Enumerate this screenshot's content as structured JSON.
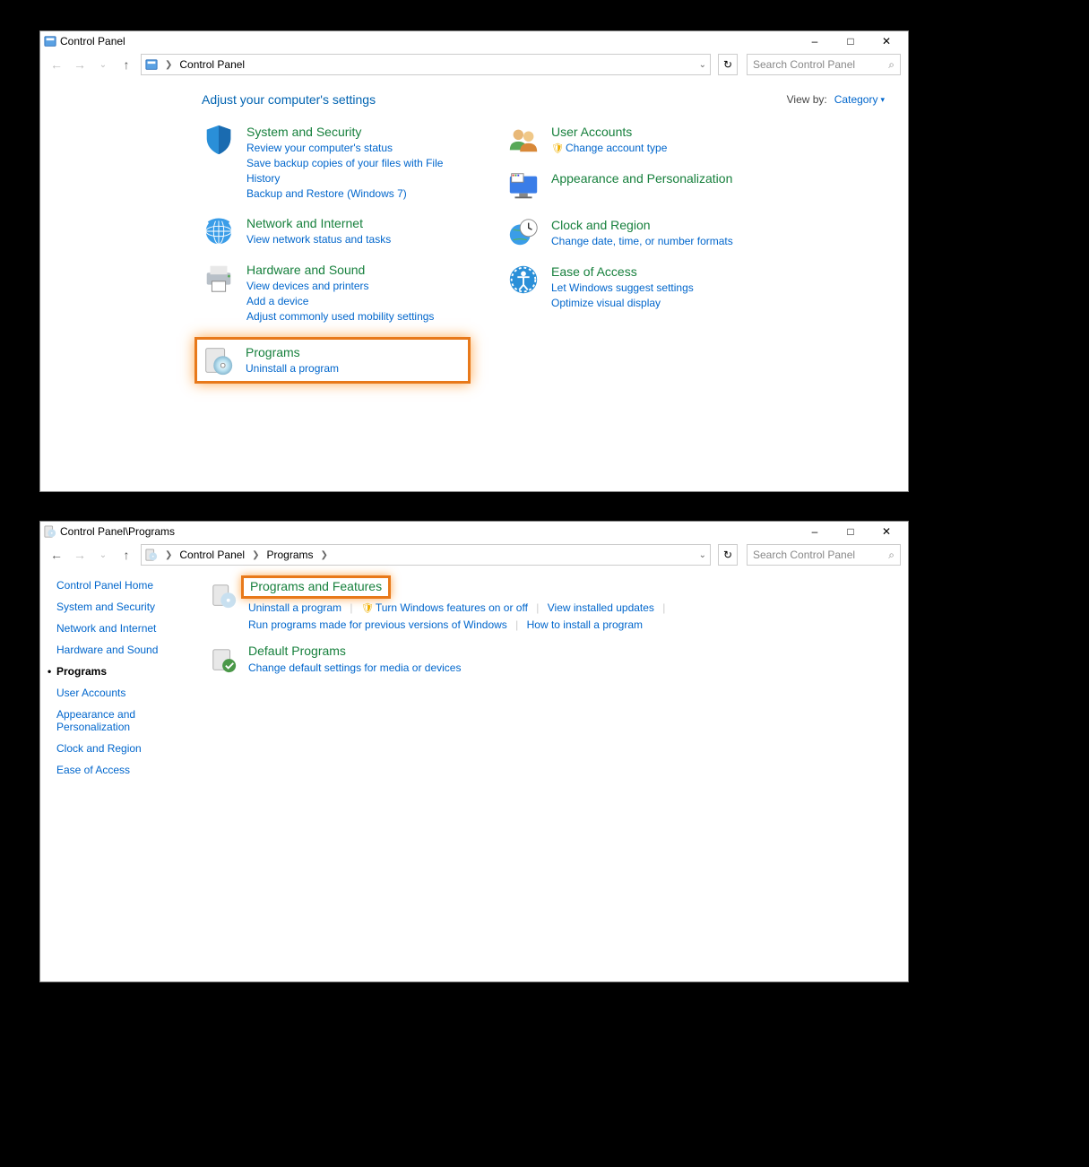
{
  "window1": {
    "title": "Control Panel",
    "breadcrumb": "Control Panel",
    "search_placeholder": "Search Control Panel",
    "heading": "Adjust your computer's settings",
    "viewby_label": "View by:",
    "viewby_value": "Category",
    "left_col": [
      {
        "title": "System and Security",
        "tasks": [
          "Review your computer's status",
          "Save backup copies of your files with File History",
          "Backup and Restore (Windows 7)"
        ]
      },
      {
        "title": "Network and Internet",
        "tasks": [
          "View network status and tasks"
        ]
      },
      {
        "title": "Hardware and Sound",
        "tasks": [
          "View devices and printers",
          "Add a device",
          "Adjust commonly used mobility settings"
        ]
      },
      {
        "title": "Programs",
        "tasks": [
          "Uninstall a program"
        ]
      }
    ],
    "right_col": [
      {
        "title": "User Accounts",
        "tasks": [
          "Change account type"
        ]
      },
      {
        "title": "Appearance and Personalization",
        "tasks": []
      },
      {
        "title": "Clock and Region",
        "tasks": [
          "Change date, time, or number formats"
        ]
      },
      {
        "title": "Ease of Access",
        "tasks": [
          "Let Windows suggest settings",
          "Optimize visual display"
        ]
      }
    ]
  },
  "window2": {
    "title": "Control Panel\\Programs",
    "breadcrumb": [
      "Control Panel",
      "Programs"
    ],
    "search_placeholder": "Search Control Panel",
    "sidebar": [
      "Control Panel Home",
      "System and Security",
      "Network and Internet",
      "Hardware and Sound",
      "Programs",
      "User Accounts",
      "Appearance and Personalization",
      "Clock and Region",
      "Ease of Access"
    ],
    "sidebar_current": "Programs",
    "groups": [
      {
        "title": "Programs and Features",
        "highlighted": true,
        "links": [
          "Uninstall a program",
          "Turn Windows features on or off",
          "View installed updates",
          "Run programs made for previous versions of Windows",
          "How to install a program"
        ],
        "shield_at": 1
      },
      {
        "title": "Default Programs",
        "highlighted": false,
        "links": [
          "Change default settings for media or devices"
        ]
      }
    ]
  }
}
